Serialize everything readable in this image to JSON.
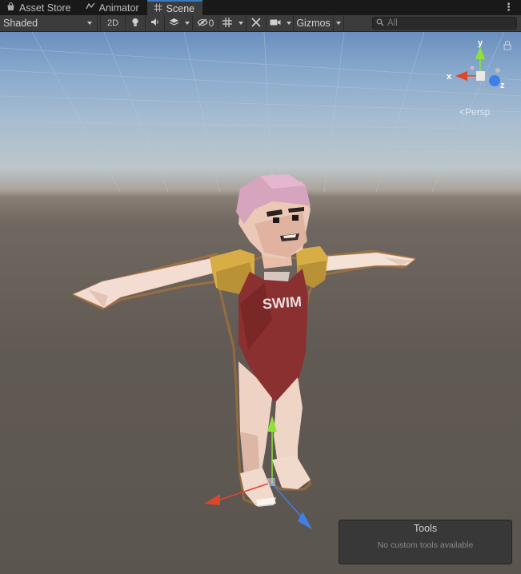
{
  "tabs": [
    {
      "label": "Asset Store",
      "icon": "shopping-bag-icon"
    },
    {
      "label": "Animator",
      "icon": "animator-icon"
    },
    {
      "label": "Scene",
      "icon": "scene-grid-icon"
    }
  ],
  "active_tab": "Scene",
  "toolbar": {
    "shading_mode": "Shaded",
    "mode_2d_label": "2D",
    "hidden_count": "0",
    "gizmos_label": "Gizmos",
    "search_placeholder": "All"
  },
  "orientation_gizmo": {
    "x_label": "x",
    "y_label": "y",
    "z_label": "z",
    "projection_label": "Persp"
  },
  "character_shirt_text": "SWIM",
  "tools_overlay": {
    "title": "Tools",
    "message": "No custom tools available"
  },
  "colors": {
    "selection_outline": "#f08a1a",
    "axis_x": "#e0452b",
    "axis_y": "#8ee13a",
    "axis_z": "#3f7fe6",
    "swimsuit": "#8a3030",
    "armbands": "#d9ad45"
  }
}
